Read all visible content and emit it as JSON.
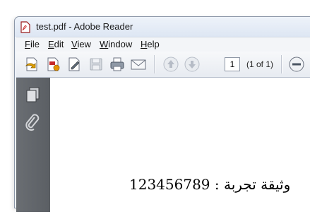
{
  "window": {
    "title": "test.pdf - Adobe Reader"
  },
  "menu": [
    {
      "key": "F",
      "rest": "ile"
    },
    {
      "key": "E",
      "rest": "dit"
    },
    {
      "key": "V",
      "rest": "iew"
    },
    {
      "key": "W",
      "rest": "indow"
    },
    {
      "key": "H",
      "rest": "elp"
    }
  ],
  "toolbar": {
    "page_number": "1",
    "page_count": "(1 of 1)",
    "icons": [
      "open-icon",
      "create-pdf-icon",
      "edit-icon",
      "save-icon",
      "print-icon",
      "email-icon",
      "previous-page-icon",
      "next-page-icon",
      "zoom-out-icon"
    ]
  },
  "sidepanel": {
    "icons": [
      "pages-icon",
      "attachments-icon"
    ]
  },
  "document": {
    "text": "وثيقة تجربة : 123456789"
  },
  "colors": {
    "titlebar": "#dde6f3",
    "sidepanel": "#5f6368",
    "page": "#ffffff"
  }
}
